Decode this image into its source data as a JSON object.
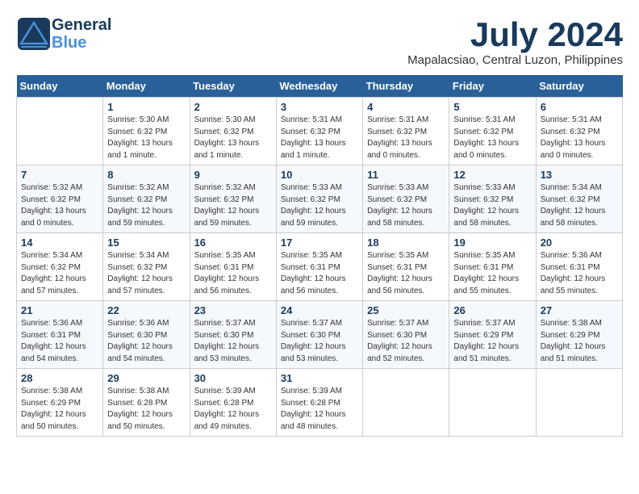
{
  "header": {
    "logo": {
      "line1": "General",
      "line2": "Blue"
    },
    "month_year": "July 2024",
    "location": "Mapalacsiao, Central Luzon, Philippines"
  },
  "weekdays": [
    "Sunday",
    "Monday",
    "Tuesday",
    "Wednesday",
    "Thursday",
    "Friday",
    "Saturday"
  ],
  "weeks": [
    [
      {
        "day": "",
        "info": ""
      },
      {
        "day": "1",
        "info": "Sunrise: 5:30 AM\nSunset: 6:32 PM\nDaylight: 13 hours\nand 1 minute."
      },
      {
        "day": "2",
        "info": "Sunrise: 5:30 AM\nSunset: 6:32 PM\nDaylight: 13 hours\nand 1 minute."
      },
      {
        "day": "3",
        "info": "Sunrise: 5:31 AM\nSunset: 6:32 PM\nDaylight: 13 hours\nand 1 minute."
      },
      {
        "day": "4",
        "info": "Sunrise: 5:31 AM\nSunset: 6:32 PM\nDaylight: 13 hours\nand 0 minutes."
      },
      {
        "day": "5",
        "info": "Sunrise: 5:31 AM\nSunset: 6:32 PM\nDaylight: 13 hours\nand 0 minutes."
      },
      {
        "day": "6",
        "info": "Sunrise: 5:31 AM\nSunset: 6:32 PM\nDaylight: 13 hours\nand 0 minutes."
      }
    ],
    [
      {
        "day": "7",
        "info": "Sunrise: 5:32 AM\nSunset: 6:32 PM\nDaylight: 13 hours\nand 0 minutes."
      },
      {
        "day": "8",
        "info": "Sunrise: 5:32 AM\nSunset: 6:32 PM\nDaylight: 12 hours\nand 59 minutes."
      },
      {
        "day": "9",
        "info": "Sunrise: 5:32 AM\nSunset: 6:32 PM\nDaylight: 12 hours\nand 59 minutes."
      },
      {
        "day": "10",
        "info": "Sunrise: 5:33 AM\nSunset: 6:32 PM\nDaylight: 12 hours\nand 59 minutes."
      },
      {
        "day": "11",
        "info": "Sunrise: 5:33 AM\nSunset: 6:32 PM\nDaylight: 12 hours\nand 58 minutes."
      },
      {
        "day": "12",
        "info": "Sunrise: 5:33 AM\nSunset: 6:32 PM\nDaylight: 12 hours\nand 58 minutes."
      },
      {
        "day": "13",
        "info": "Sunrise: 5:34 AM\nSunset: 6:32 PM\nDaylight: 12 hours\nand 58 minutes."
      }
    ],
    [
      {
        "day": "14",
        "info": "Sunrise: 5:34 AM\nSunset: 6:32 PM\nDaylight: 12 hours\nand 57 minutes."
      },
      {
        "day": "15",
        "info": "Sunrise: 5:34 AM\nSunset: 6:32 PM\nDaylight: 12 hours\nand 57 minutes."
      },
      {
        "day": "16",
        "info": "Sunrise: 5:35 AM\nSunset: 6:31 PM\nDaylight: 12 hours\nand 56 minutes."
      },
      {
        "day": "17",
        "info": "Sunrise: 5:35 AM\nSunset: 6:31 PM\nDaylight: 12 hours\nand 56 minutes."
      },
      {
        "day": "18",
        "info": "Sunrise: 5:35 AM\nSunset: 6:31 PM\nDaylight: 12 hours\nand 56 minutes."
      },
      {
        "day": "19",
        "info": "Sunrise: 5:35 AM\nSunset: 6:31 PM\nDaylight: 12 hours\nand 55 minutes."
      },
      {
        "day": "20",
        "info": "Sunrise: 5:36 AM\nSunset: 6:31 PM\nDaylight: 12 hours\nand 55 minutes."
      }
    ],
    [
      {
        "day": "21",
        "info": "Sunrise: 5:36 AM\nSunset: 6:31 PM\nDaylight: 12 hours\nand 54 minutes."
      },
      {
        "day": "22",
        "info": "Sunrise: 5:36 AM\nSunset: 6:30 PM\nDaylight: 12 hours\nand 54 minutes."
      },
      {
        "day": "23",
        "info": "Sunrise: 5:37 AM\nSunset: 6:30 PM\nDaylight: 12 hours\nand 53 minutes."
      },
      {
        "day": "24",
        "info": "Sunrise: 5:37 AM\nSunset: 6:30 PM\nDaylight: 12 hours\nand 53 minutes."
      },
      {
        "day": "25",
        "info": "Sunrise: 5:37 AM\nSunset: 6:30 PM\nDaylight: 12 hours\nand 52 minutes."
      },
      {
        "day": "26",
        "info": "Sunrise: 5:37 AM\nSunset: 6:29 PM\nDaylight: 12 hours\nand 51 minutes."
      },
      {
        "day": "27",
        "info": "Sunrise: 5:38 AM\nSunset: 6:29 PM\nDaylight: 12 hours\nand 51 minutes."
      }
    ],
    [
      {
        "day": "28",
        "info": "Sunrise: 5:38 AM\nSunset: 6:29 PM\nDaylight: 12 hours\nand 50 minutes."
      },
      {
        "day": "29",
        "info": "Sunrise: 5:38 AM\nSunset: 6:28 PM\nDaylight: 12 hours\nand 50 minutes."
      },
      {
        "day": "30",
        "info": "Sunrise: 5:39 AM\nSunset: 6:28 PM\nDaylight: 12 hours\nand 49 minutes."
      },
      {
        "day": "31",
        "info": "Sunrise: 5:39 AM\nSunset: 6:28 PM\nDaylight: 12 hours\nand 48 minutes."
      },
      {
        "day": "",
        "info": ""
      },
      {
        "day": "",
        "info": ""
      },
      {
        "day": "",
        "info": ""
      }
    ]
  ]
}
